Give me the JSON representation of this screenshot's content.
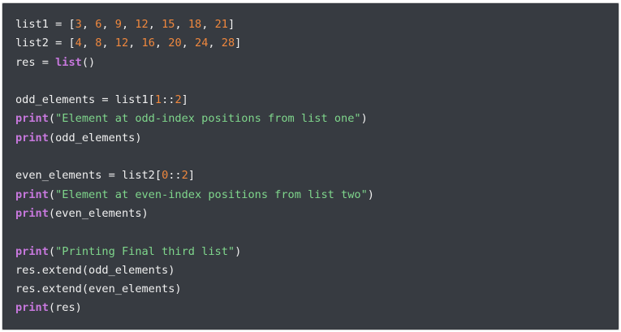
{
  "code": {
    "language": "python",
    "colors": {
      "background": "#373b41",
      "text": "#f0f0f0",
      "number": "#f0883e",
      "string": "#7fd68c",
      "builtin": "#c778dd"
    },
    "lines": [
      [
        {
          "t": "text",
          "v": "list1 = ["
        },
        {
          "t": "num",
          "v": "3"
        },
        {
          "t": "text",
          "v": ", "
        },
        {
          "t": "num",
          "v": "6"
        },
        {
          "t": "text",
          "v": ", "
        },
        {
          "t": "num",
          "v": "9"
        },
        {
          "t": "text",
          "v": ", "
        },
        {
          "t": "num",
          "v": "12"
        },
        {
          "t": "text",
          "v": ", "
        },
        {
          "t": "num",
          "v": "15"
        },
        {
          "t": "text",
          "v": ", "
        },
        {
          "t": "num",
          "v": "18"
        },
        {
          "t": "text",
          "v": ", "
        },
        {
          "t": "num",
          "v": "21"
        },
        {
          "t": "text",
          "v": "]"
        }
      ],
      [
        {
          "t": "text",
          "v": "list2 = ["
        },
        {
          "t": "num",
          "v": "4"
        },
        {
          "t": "text",
          "v": ", "
        },
        {
          "t": "num",
          "v": "8"
        },
        {
          "t": "text",
          "v": ", "
        },
        {
          "t": "num",
          "v": "12"
        },
        {
          "t": "text",
          "v": ", "
        },
        {
          "t": "num",
          "v": "16"
        },
        {
          "t": "text",
          "v": ", "
        },
        {
          "t": "num",
          "v": "20"
        },
        {
          "t": "text",
          "v": ", "
        },
        {
          "t": "num",
          "v": "24"
        },
        {
          "t": "text",
          "v": ", "
        },
        {
          "t": "num",
          "v": "28"
        },
        {
          "t": "text",
          "v": "]"
        }
      ],
      [
        {
          "t": "text",
          "v": "res = "
        },
        {
          "t": "kw",
          "v": "list"
        },
        {
          "t": "text",
          "v": "()"
        }
      ],
      [],
      [
        {
          "t": "text",
          "v": "odd_elements = list1["
        },
        {
          "t": "num",
          "v": "1"
        },
        {
          "t": "text",
          "v": "::"
        },
        {
          "t": "num",
          "v": "2"
        },
        {
          "t": "text",
          "v": "]"
        }
      ],
      [
        {
          "t": "kw",
          "v": "print"
        },
        {
          "t": "text",
          "v": "("
        },
        {
          "t": "str",
          "v": "\"Element at odd-index positions from list one\""
        },
        {
          "t": "text",
          "v": ")"
        }
      ],
      [
        {
          "t": "kw",
          "v": "print"
        },
        {
          "t": "text",
          "v": "(odd_elements)"
        }
      ],
      [],
      [
        {
          "t": "text",
          "v": "even_elements = list2["
        },
        {
          "t": "num",
          "v": "0"
        },
        {
          "t": "text",
          "v": "::"
        },
        {
          "t": "num",
          "v": "2"
        },
        {
          "t": "text",
          "v": "]"
        }
      ],
      [
        {
          "t": "kw",
          "v": "print"
        },
        {
          "t": "text",
          "v": "("
        },
        {
          "t": "str",
          "v": "\"Element at even-index positions from list two\""
        },
        {
          "t": "text",
          "v": ")"
        }
      ],
      [
        {
          "t": "kw",
          "v": "print"
        },
        {
          "t": "text",
          "v": "(even_elements)"
        }
      ],
      [],
      [
        {
          "t": "kw",
          "v": "print"
        },
        {
          "t": "text",
          "v": "("
        },
        {
          "t": "str",
          "v": "\"Printing Final third list\""
        },
        {
          "t": "text",
          "v": ")"
        }
      ],
      [
        {
          "t": "text",
          "v": "res.extend(odd_elements)"
        }
      ],
      [
        {
          "t": "text",
          "v": "res.extend(even_elements)"
        }
      ],
      [
        {
          "t": "kw",
          "v": "print"
        },
        {
          "t": "text",
          "v": "(res)"
        }
      ]
    ]
  }
}
